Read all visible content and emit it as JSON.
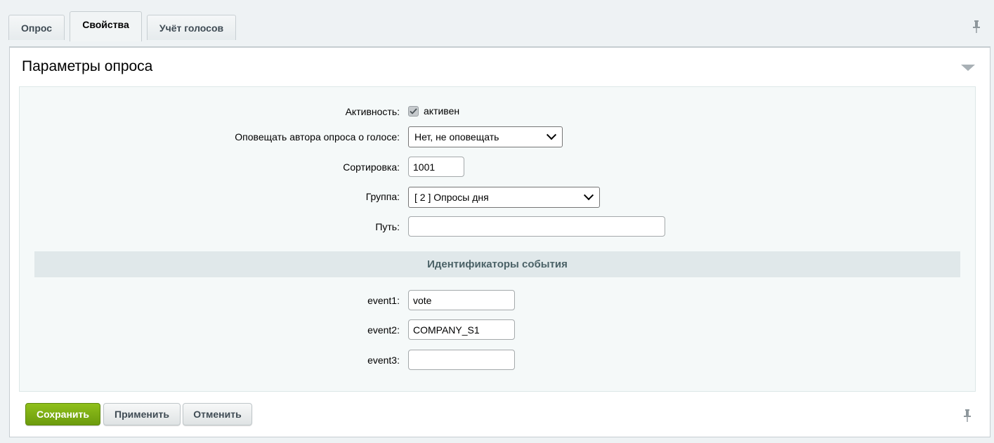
{
  "tabs": [
    {
      "label": "Опрос",
      "active": false
    },
    {
      "label": "Свойства",
      "active": true
    },
    {
      "label": "Учёт голосов",
      "active": false
    }
  ],
  "panel": {
    "title": "Параметры опроса"
  },
  "form": {
    "active": {
      "label": "Активность:",
      "checkbox_label": "активен",
      "checked": true
    },
    "notify": {
      "label": "Оповещать автора опроса о голосе:",
      "value": "Нет, не оповещать"
    },
    "sort": {
      "label": "Сортировка:",
      "value": "1001"
    },
    "group": {
      "label": "Группа:",
      "value": "[ 2 ] Опросы дня"
    },
    "path": {
      "label": "Путь:",
      "value": ""
    },
    "section_title": "Идентификаторы события",
    "event1": {
      "label": "event1:",
      "value": "vote"
    },
    "event2": {
      "label": "event2:",
      "value": "COMPANY_S1"
    },
    "event3": {
      "label": "event3:",
      "value": ""
    }
  },
  "buttons": {
    "save": "Сохранить",
    "apply": "Применить",
    "cancel": "Отменить"
  },
  "colors": {
    "accent_green": "#7aab12",
    "background": "#eef2f4"
  }
}
